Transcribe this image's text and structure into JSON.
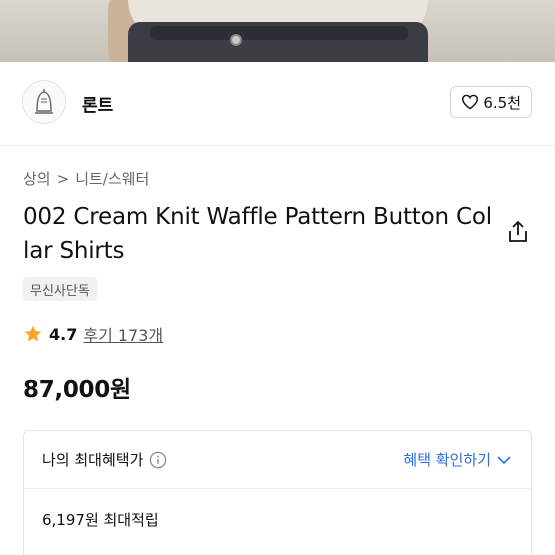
{
  "hero": {
    "alt": "product photo"
  },
  "brand": {
    "name": "론트",
    "logo_icon": "brand-logo-icon"
  },
  "like": {
    "icon": "heart-icon",
    "count": "6.5천"
  },
  "breadcrumb": {
    "category": "상의",
    "separator": ">",
    "subcategory": "니트/스웨터"
  },
  "product": {
    "title": "002 Cream Knit Waffle Pattern Button Collar Shirts",
    "tag": "무신사단독",
    "rating": {
      "icon": "star-icon",
      "score": "4.7",
      "reviews": "후기 173개",
      "star_color": "#f5a623"
    },
    "price": "87,000원"
  },
  "benefits": {
    "title": "나의 최대혜택가",
    "info_icon": "info-icon",
    "link": "혜택 확인하기",
    "link_color": "#2f6fe0",
    "points": "6,197원 최대적립"
  }
}
